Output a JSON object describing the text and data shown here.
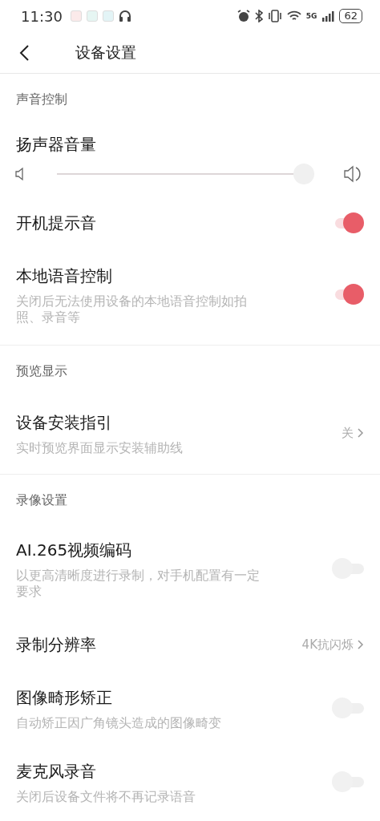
{
  "status_bar": {
    "time": "11:30",
    "network": "5G",
    "battery": "62"
  },
  "header": {
    "title": "设备设置"
  },
  "sections": [
    {
      "title": "声音控制",
      "items": [
        {
          "kind": "slider",
          "label": "扬声器音量",
          "level": 0.97
        },
        {
          "kind": "toggle",
          "label": "开机提示音",
          "on": true
        },
        {
          "kind": "toggle",
          "label": "本地语音控制",
          "on": true,
          "description": "关闭后无法使用设备的本地语音控制如拍照、录音等"
        }
      ]
    },
    {
      "title": "预览显示",
      "items": [
        {
          "kind": "link",
          "label": "设备安装指引",
          "value": "关",
          "description": "实时预览界面显示安装辅助线"
        }
      ]
    },
    {
      "title": "录像设置",
      "items": [
        {
          "kind": "toggle",
          "label": "AI.265视频编码",
          "on": false,
          "description": "以更高清晰度进行录制，对手机配置有一定要求"
        },
        {
          "kind": "link",
          "label": "录制分辨率",
          "value": "4K抗闪烁"
        },
        {
          "kind": "toggle",
          "label": "图像畸形矫正",
          "on": false,
          "description": "自动矫正因广角镜头造成的图像畸变"
        },
        {
          "kind": "toggle",
          "label": "麦克风录音",
          "on": false,
          "description": "关闭后设备文件将不再记录语音"
        }
      ]
    }
  ]
}
